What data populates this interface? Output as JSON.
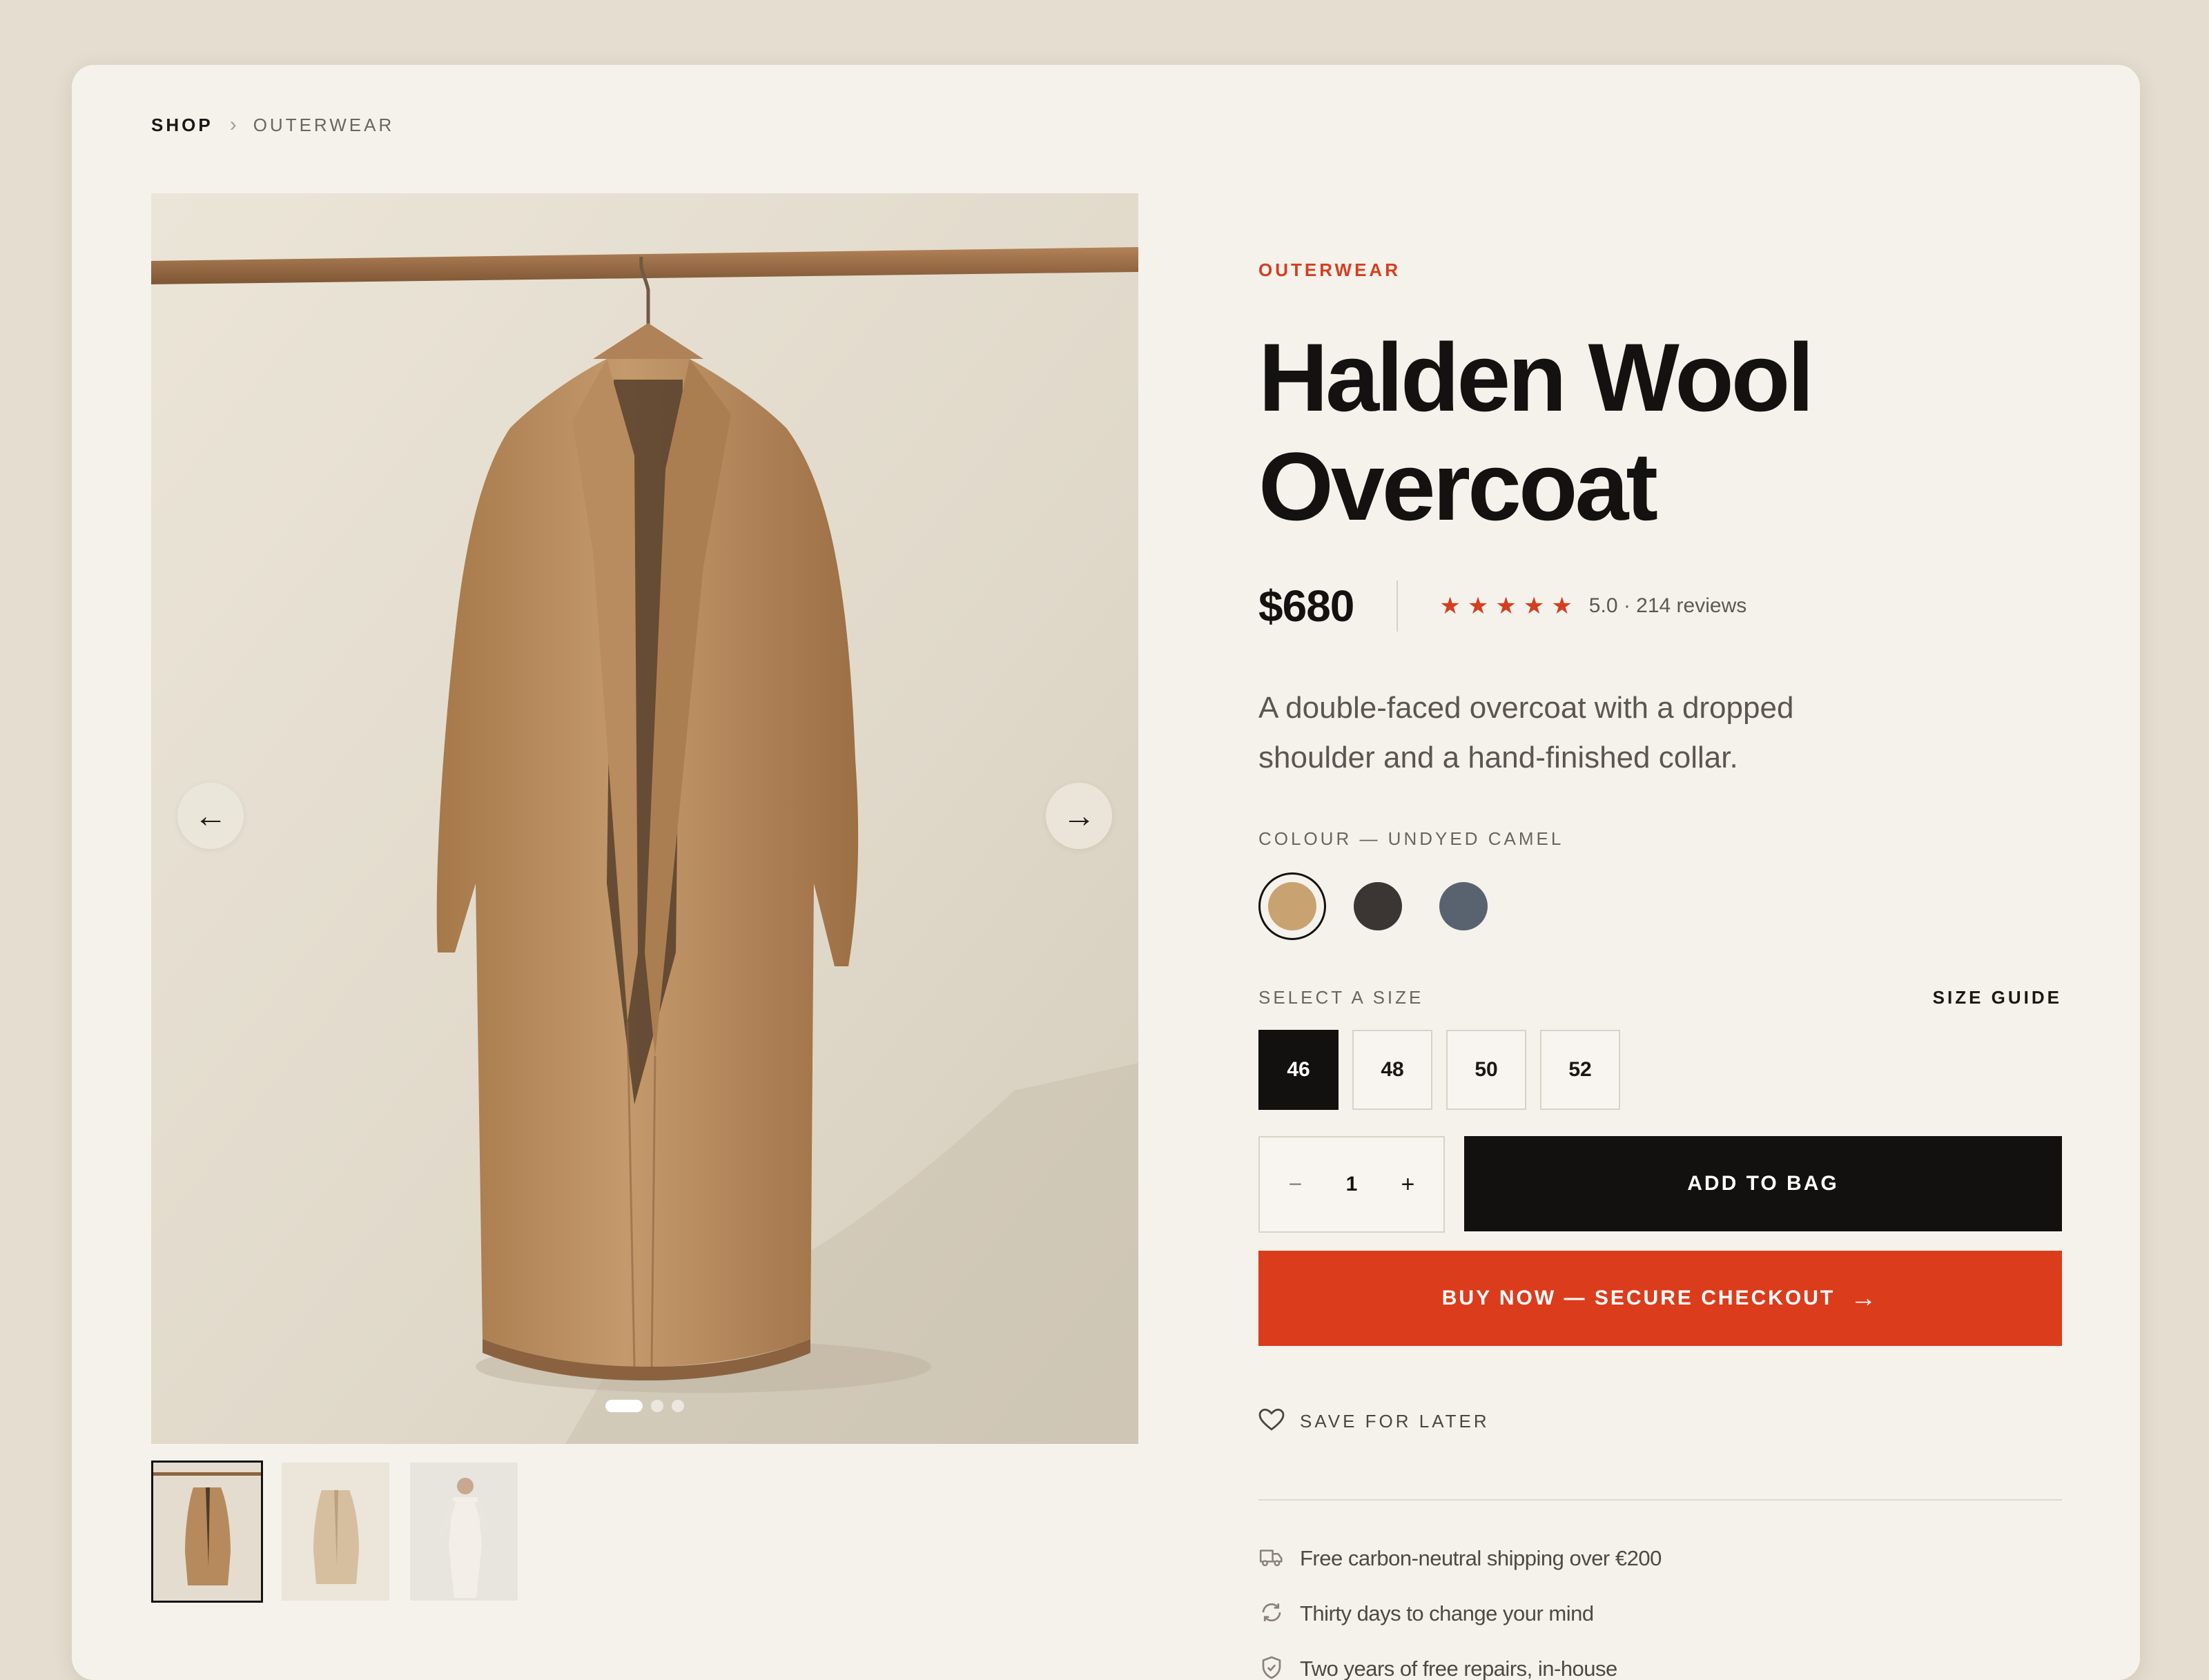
{
  "breadcrumb": {
    "shop": "SHOP",
    "separator": "›",
    "current": "OUTERWEAR"
  },
  "gallery": {
    "prev_arrow": "←",
    "next_arrow": "→",
    "active_slide": 1,
    "slide_count": 3,
    "thumbnail_count": 3,
    "active_thumbnail": 1
  },
  "product": {
    "category": "OUTERWEAR",
    "title": "Halden Wool Overcoat",
    "price": "$680",
    "stars": [
      "★",
      "★",
      "★",
      "★",
      "★"
    ],
    "rating_text": "5.0 · 214 reviews",
    "description": "A double-faced overcoat with a dropped shoulder and a hand-finished collar."
  },
  "colour": {
    "label": "COLOUR — UNDYED CAMEL",
    "swatches": [
      {
        "name": "camel",
        "color": "#c9a271",
        "selected": true
      },
      {
        "name": "charcoal",
        "color": "#3b3634",
        "selected": false
      },
      {
        "name": "slate",
        "color": "#596370",
        "selected": false
      }
    ]
  },
  "size": {
    "label": "SELECT A SIZE",
    "guide": "SIZE GUIDE",
    "options": [
      "46",
      "48",
      "50",
      "52"
    ],
    "selected": "46"
  },
  "quantity": {
    "minus": "−",
    "value": "1",
    "plus": "+"
  },
  "actions": {
    "add_to_bag": "ADD TO BAG",
    "buy_now": "BUY NOW — SECURE CHECKOUT",
    "buy_arrow": "→",
    "save_for_later": "SAVE FOR LATER"
  },
  "perks": [
    {
      "icon": "truck-icon",
      "text": "Free carbon-neutral shipping over €200"
    },
    {
      "icon": "refresh-icon",
      "text": "Thirty days to change your mind"
    },
    {
      "icon": "shield-icon",
      "text": "Two years of free repairs, in-house"
    }
  ],
  "colors": {
    "accent": "#db3c1c",
    "ink": "#121110",
    "background": "#f5f2ec",
    "page": "#e5ddd0"
  }
}
